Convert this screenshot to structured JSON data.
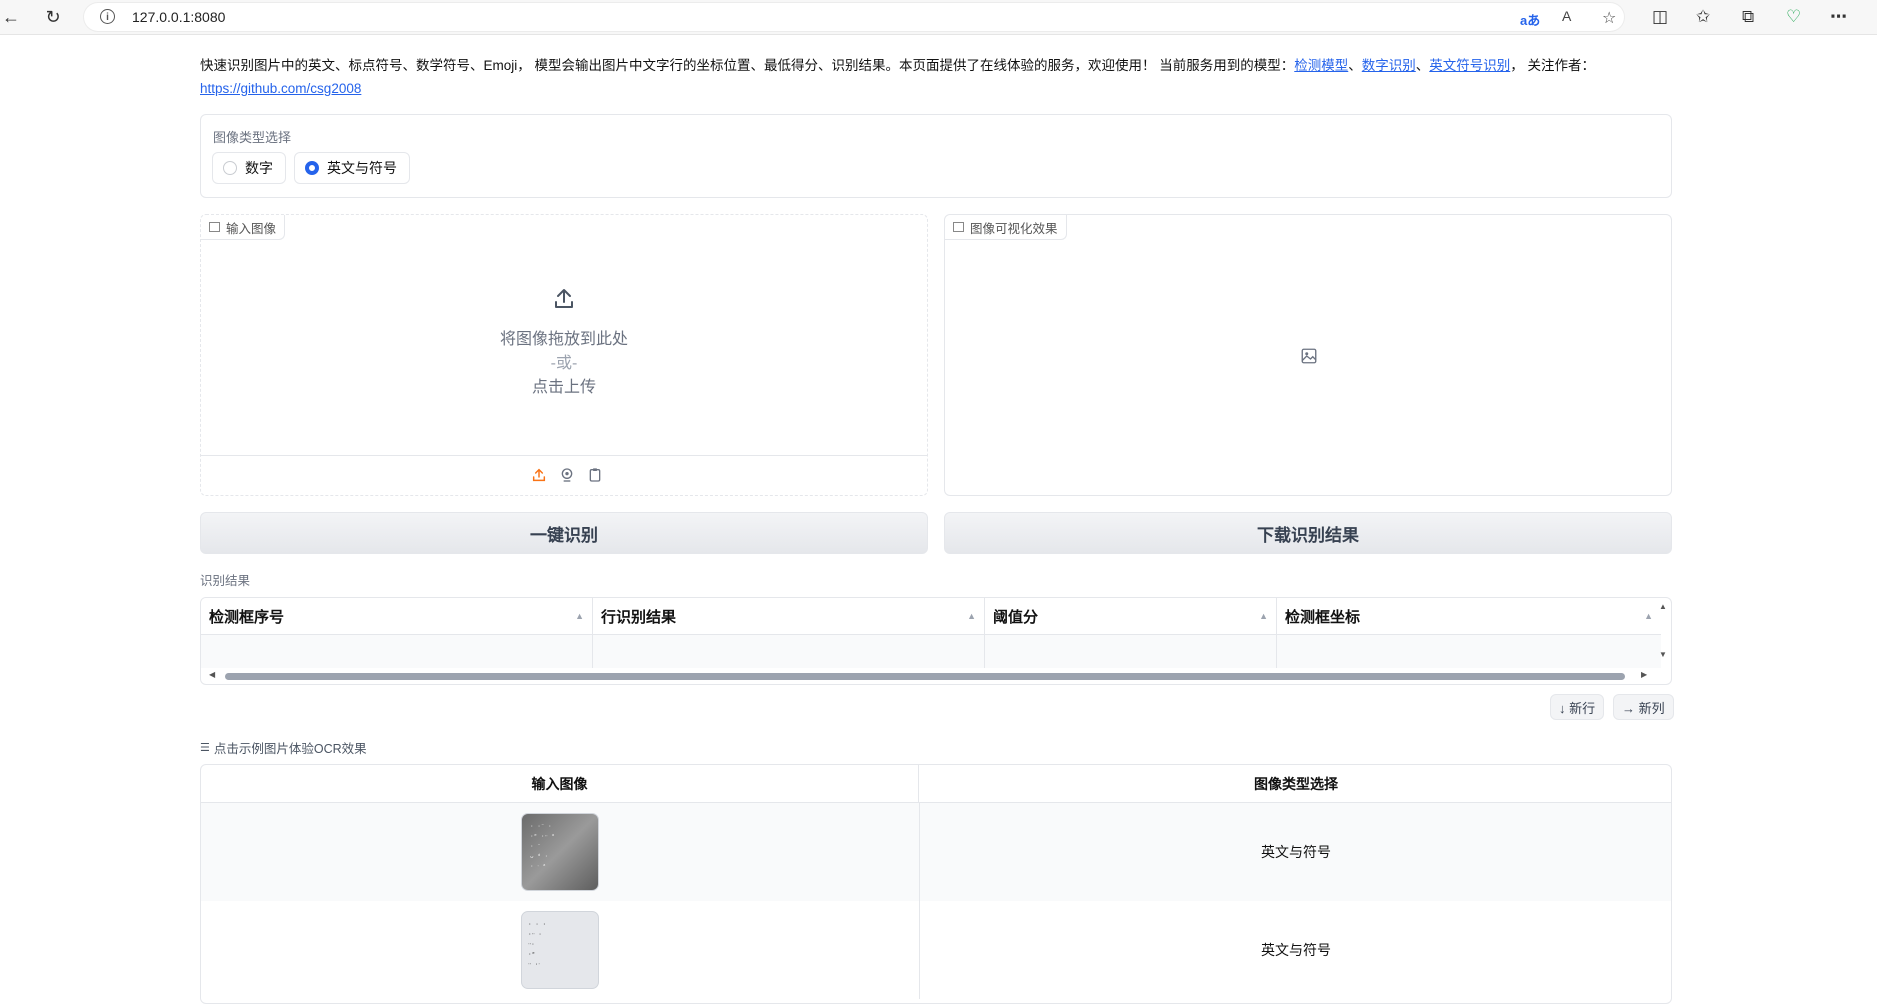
{
  "browser": {
    "url": "127.0.0.1:8080",
    "read_aloud": "A"
  },
  "intro": {
    "text": "快速识别图片中的英文、标点符号、数学符号、Emoji， 模型会输出图片中文字行的坐标位置、最低得分、识别结果。本页面提供了在线体验的服务，欢迎使用！ 当前服务用到的模型：",
    "link1": "检测模型",
    "sep1": "、",
    "link2": "数字识别",
    "sep2": "、",
    "link3": "英文符号识别",
    "after": "， 关注作者：",
    "author_link": "https://github.com/csg2008"
  },
  "image_type": {
    "label": "图像类型选择",
    "options": [
      {
        "label": "数字",
        "checked": false
      },
      {
        "label": "英文与符号",
        "checked": true
      }
    ]
  },
  "input_image": {
    "label": "输入图像",
    "drop_text": "将图像拖放到此处",
    "or_text": "-或-",
    "click_text": "点击上传"
  },
  "output_image": {
    "label": "图像可视化效果"
  },
  "buttons": {
    "recognize": "一键识别",
    "download": "下载识别结果",
    "new_row": "↓ 新行",
    "new_col": "→ 新列"
  },
  "results": {
    "label": "识别结果",
    "columns": [
      "检测框序号",
      "行识别结果",
      "阈值分",
      "检测框坐标"
    ]
  },
  "examples": {
    "label": "点击示例图片体验OCR效果",
    "headers": [
      "输入图像",
      "图像类型选择"
    ],
    "rows": [
      {
        "type": "英文与符号"
      },
      {
        "type": "英文与符号"
      }
    ]
  },
  "colors": {
    "accent": "#2563eb",
    "upload_orange": "#f97316"
  }
}
